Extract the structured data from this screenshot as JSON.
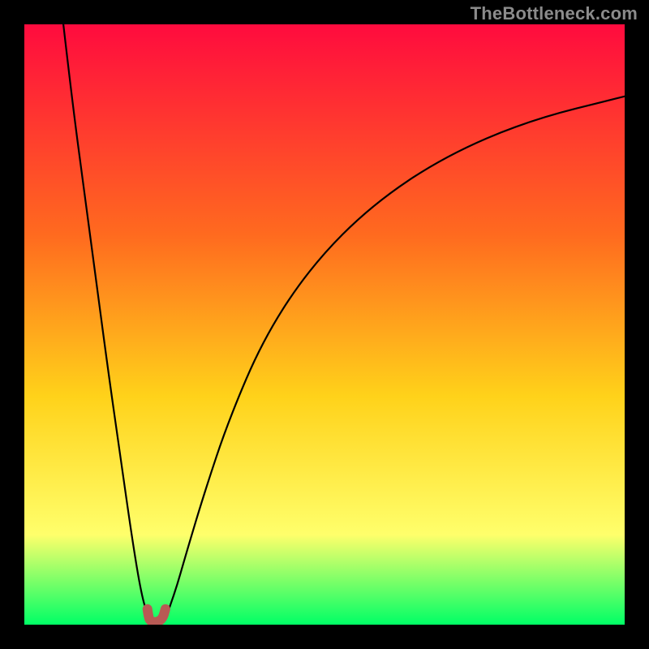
{
  "watermark": "TheBottleneck.com",
  "colors": {
    "frame": "#000000",
    "gradient_top": "#ff0b3e",
    "gradient_mid1": "#ff6a1f",
    "gradient_mid2": "#ffd21a",
    "gradient_mid3": "#ffff6b",
    "gradient_bottom": "#00ff66",
    "curve": "#000000",
    "marker": "#b85a54"
  },
  "chart_data": {
    "type": "line",
    "title": "",
    "xlabel": "",
    "ylabel": "",
    "xlim": [
      0,
      100
    ],
    "ylim": [
      0,
      100
    ],
    "series": [
      {
        "name": "left-branch",
        "x": [
          6.5,
          8,
          10,
          12,
          14,
          16,
          18,
          19.5,
          20.7
        ],
        "y": [
          100,
          87,
          72,
          57,
          42,
          28,
          14,
          5,
          1
        ]
      },
      {
        "name": "right-branch",
        "x": [
          23.5,
          25,
          27,
          30,
          34,
          40,
          48,
          58,
          70,
          84,
          100
        ],
        "y": [
          1,
          5,
          12,
          22,
          34,
          48,
          60,
          70,
          78,
          84,
          88
        ]
      }
    ],
    "marker": {
      "name": "bottleneck-sweet-spot",
      "shape": "u",
      "x_center": 22,
      "x": [
        20.5,
        20.7,
        21.0,
        21.7,
        22.5,
        23.1,
        23.5
      ],
      "y": [
        2.6,
        1.2,
        0.6,
        0.4,
        0.6,
        1.2,
        2.6
      ]
    }
  }
}
